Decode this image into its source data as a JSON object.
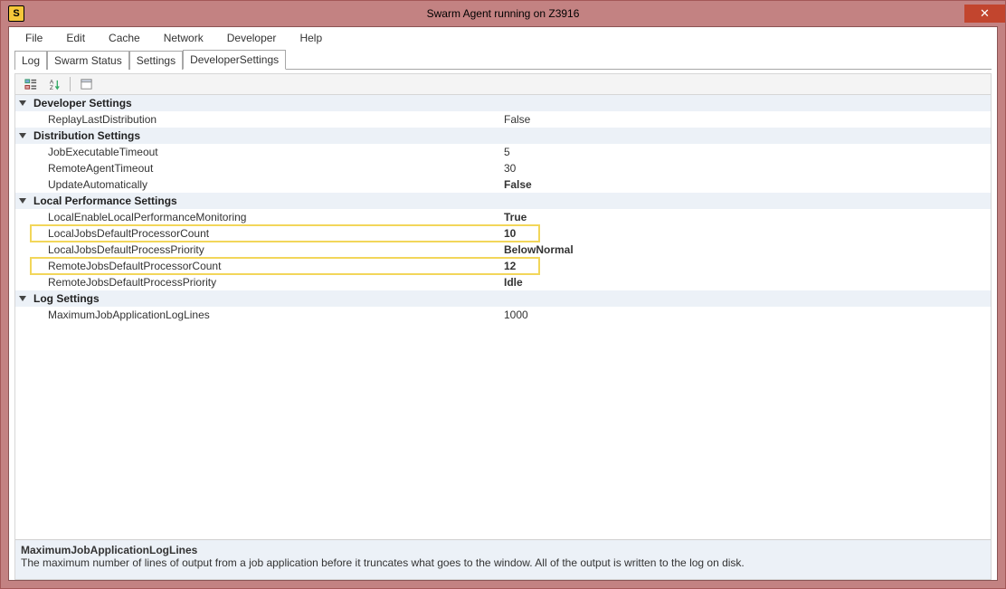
{
  "window": {
    "title": "Swarm Agent running on Z3916"
  },
  "menu": [
    "File",
    "Edit",
    "Cache",
    "Network",
    "Developer",
    "Help"
  ],
  "tabs": [
    "Log",
    "Swarm Status",
    "Settings",
    "DeveloperSettings"
  ],
  "activeTab": 3,
  "categories": [
    {
      "title": "Developer Settings",
      "items": [
        {
          "name": "ReplayLastDistribution",
          "value": "False",
          "bold": false,
          "hl": false
        }
      ]
    },
    {
      "title": "Distribution Settings",
      "items": [
        {
          "name": "JobExecutableTimeout",
          "value": "5",
          "bold": false,
          "hl": false
        },
        {
          "name": "RemoteAgentTimeout",
          "value": "30",
          "bold": false,
          "hl": false
        },
        {
          "name": "UpdateAutomatically",
          "value": "False",
          "bold": true,
          "hl": false
        }
      ]
    },
    {
      "title": "Local Performance Settings",
      "items": [
        {
          "name": "LocalEnableLocalPerformanceMonitoring",
          "value": "True",
          "bold": true,
          "hl": false
        },
        {
          "name": "LocalJobsDefaultProcessorCount",
          "value": "10",
          "bold": true,
          "hl": true
        },
        {
          "name": "LocalJobsDefaultProcessPriority",
          "value": "BelowNormal",
          "bold": true,
          "hl": false
        },
        {
          "name": "RemoteJobsDefaultProcessorCount",
          "value": "12",
          "bold": true,
          "hl": true
        },
        {
          "name": "RemoteJobsDefaultProcessPriority",
          "value": "Idle",
          "bold": true,
          "hl": false
        }
      ]
    },
    {
      "title": "Log Settings",
      "items": [
        {
          "name": "MaximumJobApplicationLogLines",
          "value": "1000",
          "bold": false,
          "hl": false
        }
      ]
    }
  ],
  "desc": {
    "title": "MaximumJobApplicationLogLines",
    "text": "The maximum number of lines of output from a job application before it truncates what goes to the window. All of the output is written to the log on disk."
  }
}
